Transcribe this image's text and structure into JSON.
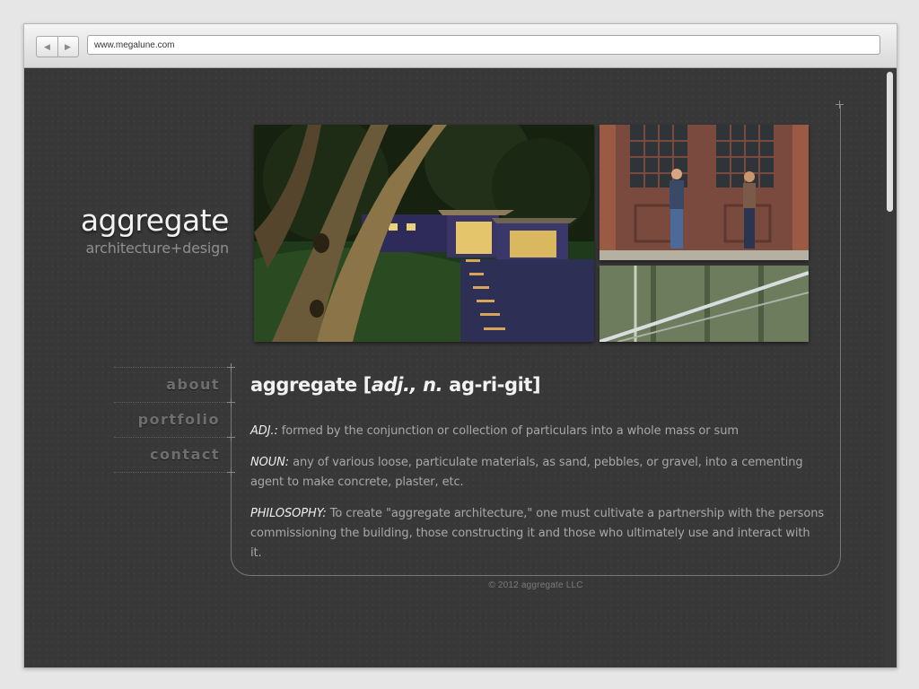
{
  "browser": {
    "back_icon": "triangle-left-icon",
    "forward_icon": "triangle-right-icon",
    "url": "www.megalune.com"
  },
  "site": {
    "name": "aggregate",
    "tagline": "architecture+design"
  },
  "nav": [
    {
      "label": "about"
    },
    {
      "label": "portfolio"
    },
    {
      "label": "contact"
    }
  ],
  "definition": {
    "word": "aggregate",
    "open_bracket": " [",
    "pos": "adj., n.",
    "space": " ",
    "pron_bold": "ag",
    "pron_rest": "-ri-git",
    "close_bracket": "]"
  },
  "paragraphs": [
    {
      "term": "ADJ.:",
      "text": " formed by the conjunction or collection of particulars into a whole mass or sum"
    },
    {
      "term": "NOUN:",
      "text": " any of various loose, particulate materials, as sand, pebbles, or gravel, into a cementing agent to make concrete, plaster, etc."
    },
    {
      "term": "PHILOSOPHY:",
      "text": " To create \"aggregate architecture,\" one must cultivate a partnership with the persons commissioning the building, those constructing it and those who ultimately use and interact with it."
    }
  ],
  "footer": "© 2012 aggregate LLC",
  "colors": {
    "page_background": "#383838",
    "heading": "#f2f2f2",
    "body_text": "#a8a8a8",
    "nav_text": "#6e6e6e"
  }
}
